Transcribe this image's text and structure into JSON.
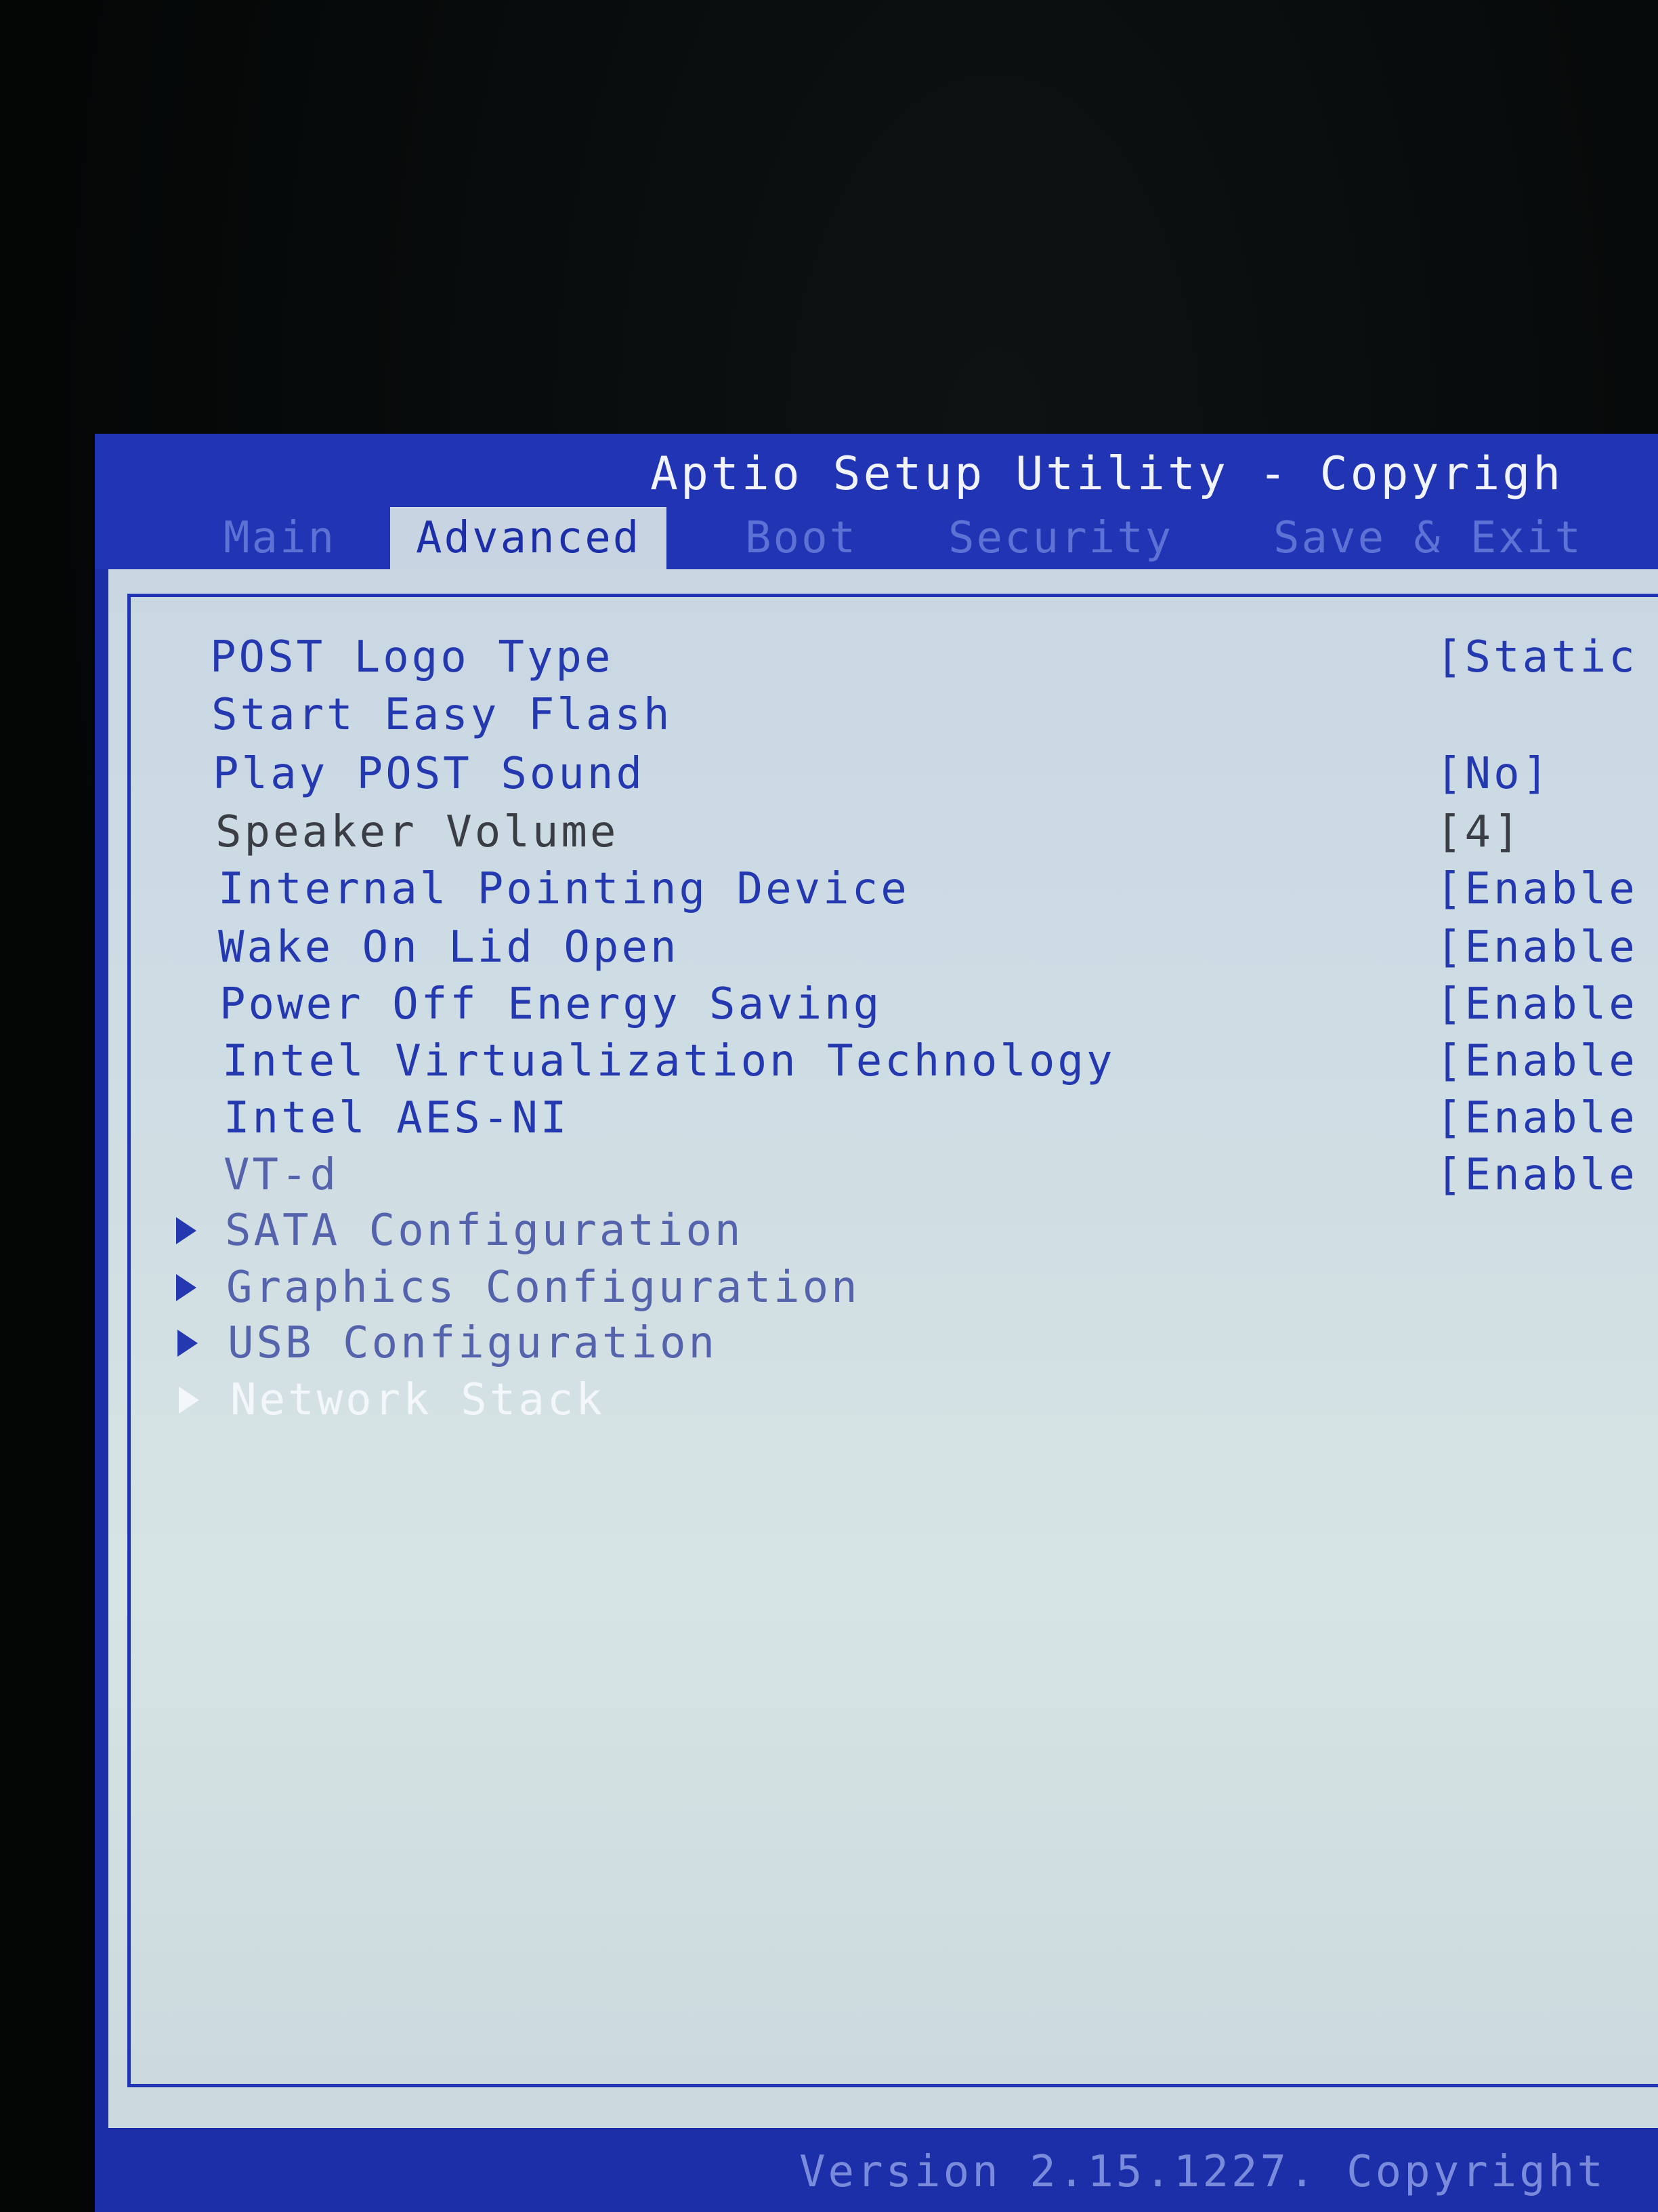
{
  "header": {
    "title": "Aptio Setup Utility - Copyrigh"
  },
  "tabs": [
    {
      "label": "Main",
      "active": false
    },
    {
      "label": "Advanced",
      "active": true
    },
    {
      "label": "Boot",
      "active": false
    },
    {
      "label": "Security",
      "active": false
    },
    {
      "label": "Save & Exit",
      "active": false
    }
  ],
  "settings": [
    {
      "label": "POST Logo Type",
      "value": "[Static"
    },
    {
      "label": "Start Easy Flash",
      "value": ""
    },
    {
      "label": "Play POST Sound",
      "value": "[No]"
    },
    {
      "label": "Speaker Volume",
      "value": "[4]"
    },
    {
      "label": "Internal Pointing Device",
      "value": "[Enable"
    },
    {
      "label": "Wake On Lid Open",
      "value": "[Enable"
    },
    {
      "label": "Power Off Energy Saving",
      "value": "[Enable"
    },
    {
      "label": "Intel Virtualization Technology",
      "value": "[Enable"
    },
    {
      "label": "Intel AES-NI",
      "value": "[Enable"
    },
    {
      "label": "VT-d",
      "value": "[Enable"
    }
  ],
  "submenus": [
    {
      "label": "SATA Configuration"
    },
    {
      "label": "Graphics Configuration"
    },
    {
      "label": "USB Configuration"
    },
    {
      "label": "Network Stack",
      "selected": true
    }
  ],
  "footer": {
    "text": "Version 2.15.1227. Copyright"
  },
  "colors": {
    "frame_blue": "#1c2fa8",
    "panel": "#cfdde4",
    "text_blue": "#2438b0",
    "highlight": "#f4f7fa"
  }
}
